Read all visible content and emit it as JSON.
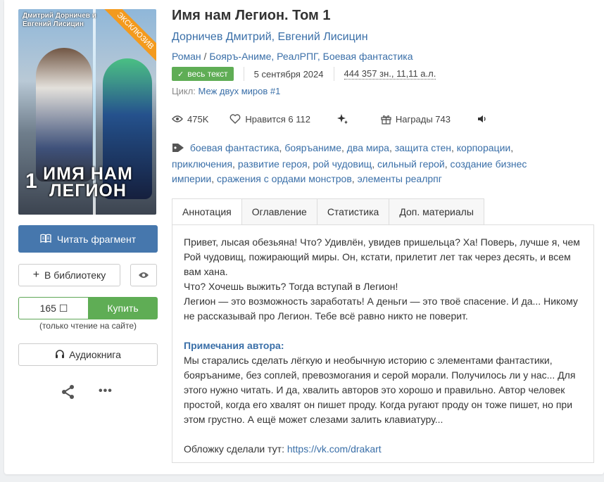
{
  "book": {
    "title": "Имя нам Легион. Том 1",
    "authors": "Дорничев Дмитрий, Евгений Лисицин",
    "genre_main": "Роман",
    "genre_sep": "/",
    "genres_rest": "Бояръ-Аниме, РеалРПГ, Боевая фантастика",
    "status_badge": "весь текст",
    "date": "5 сентября 2024",
    "size": "444 357 зн., 11,11 а.л.",
    "cycle_label": "Цикл:",
    "cycle_value": "Меж двух миров #1"
  },
  "cover": {
    "ribbon": "ЭКСКЛЮЗИВ",
    "authors_text": "Дмитрий Дорничев и Евгений Лисицин",
    "volume": "1",
    "title_text": "ИМЯ НАМ ЛЕГИОН"
  },
  "actions": {
    "read_fragment": "Читать фрагмент",
    "add_library": "В библиотеку",
    "price": "165 ☐",
    "buy": "Купить",
    "note": "(только чтение на сайте)",
    "audiobook": "Аудиокнига",
    "more": "•••"
  },
  "stats": {
    "views": "475K",
    "likes": "Нравится 6 112",
    "awards": "Награды 743"
  },
  "tags": [
    "боевая фантастика",
    "бояръаниме",
    "два мира",
    "защита стен",
    "корпорации",
    "приключения",
    "развитие героя",
    "рой чудовищ",
    "сильный герой",
    "создание бизнес империи",
    "сражения с ордами монстров",
    "элементы реалрпг"
  ],
  "tabs": [
    "Аннотация",
    "Оглавление",
    "Статистика",
    "Доп. материалы"
  ],
  "annotation": {
    "p1": "Привет, лысая обезьяна! Что? Удивлён, увидев пришельца? Ха! Поверь, лучше я, чем Рой чудовищ, пожирающий миры. Он, кстати, прилетит лет так через десять, и всем вам хана.",
    "p2": "Что? Хочешь выжить? Тогда вступай в Легион!",
    "p3": "Легион — это возможность заработать! А деньги — это твоё спасение. И да... Никому не рассказывай про Легион. Тебе всё равно никто не поверит.",
    "notes_heading": "Примечания автора:",
    "notes_text": "Мы старались сделать лёгкую и необычную историю с элементами фантастики, бояръаниме, без соплей, превозмогания и серой морали. Получилось ли у нас... Для этого нужно читать. И да, хвалить авторов это хорошо и правильно. Автор человек простой, когда его хвалят он пишет проду. Когда ругают проду он тоже пишет, но при этом грустно. А ещё может слезами залить клавиатуру...",
    "cover_credit": "Обложку сделали тут:",
    "cover_url": "https://vk.com/drakart"
  },
  "colors": {
    "primary_blue": "#4677ad",
    "link_blue": "#3a6fa8",
    "green": "#5fad55",
    "ribbon_orange": "#f39a1e"
  },
  "icons": [
    "book-open-icon",
    "plus-icon",
    "eye-icon",
    "headphones-icon",
    "share-icon",
    "more-icon",
    "views-icon",
    "heart-icon",
    "sparkles-icon",
    "gift-icon",
    "speaker-icon",
    "tag-icon",
    "check-icon"
  ]
}
